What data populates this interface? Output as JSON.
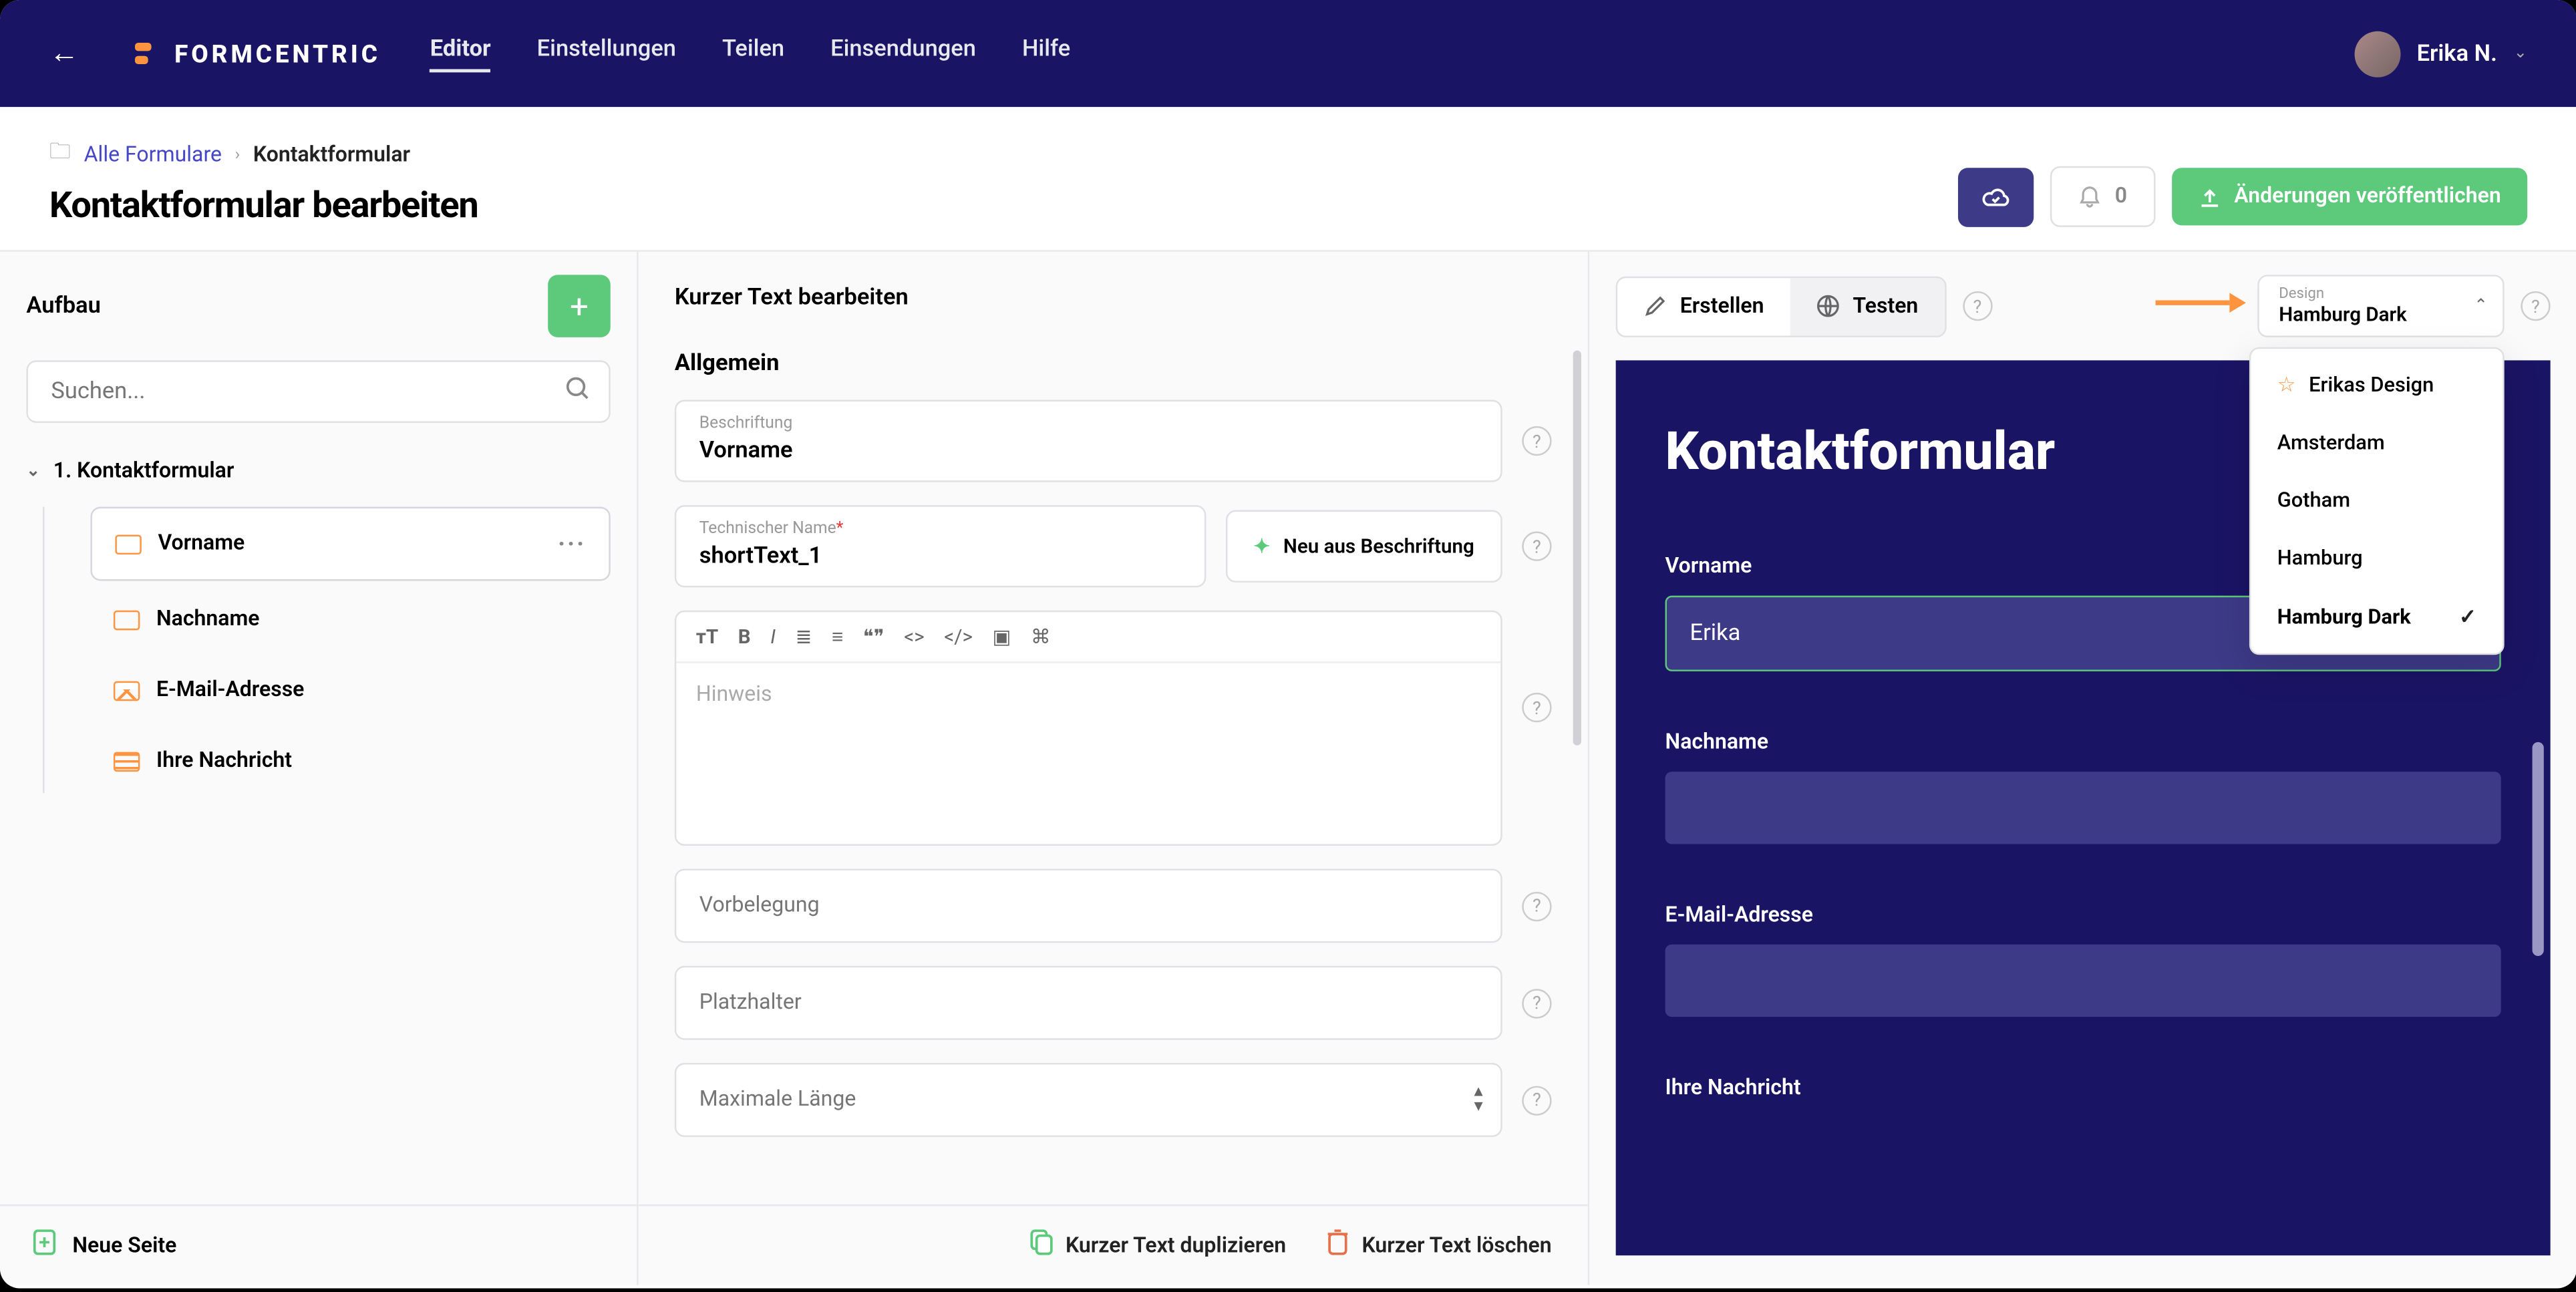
{
  "topbar": {
    "logo_text": "FORMCENTRIC",
    "nav": [
      "Editor",
      "Einstellungen",
      "Teilen",
      "Einsendungen",
      "Hilfe"
    ],
    "active_nav": 0,
    "user_name": "Erika N."
  },
  "breadcrumb": {
    "root": "Alle Formulare",
    "current": "Kontaktformular"
  },
  "page_title": "Kontaktformular bearbeiten",
  "header_actions": {
    "notif_count": "0",
    "publish_label": "Änderungen veröffentlichen"
  },
  "left": {
    "title": "Aufbau",
    "search_placeholder": "Suchen...",
    "root_node": "1. Kontaktformular",
    "items": [
      {
        "label": "Vorname",
        "selected": true,
        "type": "text"
      },
      {
        "label": "Nachname",
        "selected": false,
        "type": "text"
      },
      {
        "label": "E-Mail-Adresse",
        "selected": false,
        "type": "email"
      },
      {
        "label": "Ihre Nachricht",
        "selected": false,
        "type": "msg"
      }
    ],
    "new_page": "Neue Seite"
  },
  "mid": {
    "title": "Kurzer Text bearbeiten",
    "section": "Allgemein",
    "beschriftung_label": "Beschriftung",
    "beschriftung_value": "Vorname",
    "techname_label": "Technischer Name",
    "techname_value": "shortText_1",
    "gen_button": "Neu aus Beschriftung",
    "hinweis_placeholder": "Hinweis",
    "vorbelegung_placeholder": "Vorbelegung",
    "platzhalter_placeholder": "Platzhalter",
    "maxlen_placeholder": "Maximale Länge",
    "footer_dup": "Kurzer Text duplizieren",
    "footer_del": "Kurzer Text löschen"
  },
  "right": {
    "tab_create": "Erstellen",
    "tab_test": "Testen",
    "design_label": "Design",
    "design_value": "Hamburg Dark",
    "design_options": [
      {
        "label": "Erikas Design",
        "fav": true,
        "selected": false
      },
      {
        "label": "Amsterdam",
        "fav": false,
        "selected": false
      },
      {
        "label": "Gotham",
        "fav": false,
        "selected": false
      },
      {
        "label": "Hamburg",
        "fav": false,
        "selected": false
      },
      {
        "label": "Hamburg Dark",
        "fav": false,
        "selected": true
      }
    ],
    "preview": {
      "heading": "Kontaktformular",
      "fields": [
        {
          "label": "Vorname",
          "value": "Erika",
          "active": true
        },
        {
          "label": "Nachname",
          "value": "",
          "active": false
        },
        {
          "label": "E-Mail-Adresse",
          "value": "",
          "active": false
        },
        {
          "label": "Ihre Nachricht",
          "value": "",
          "active": false
        }
      ]
    }
  }
}
